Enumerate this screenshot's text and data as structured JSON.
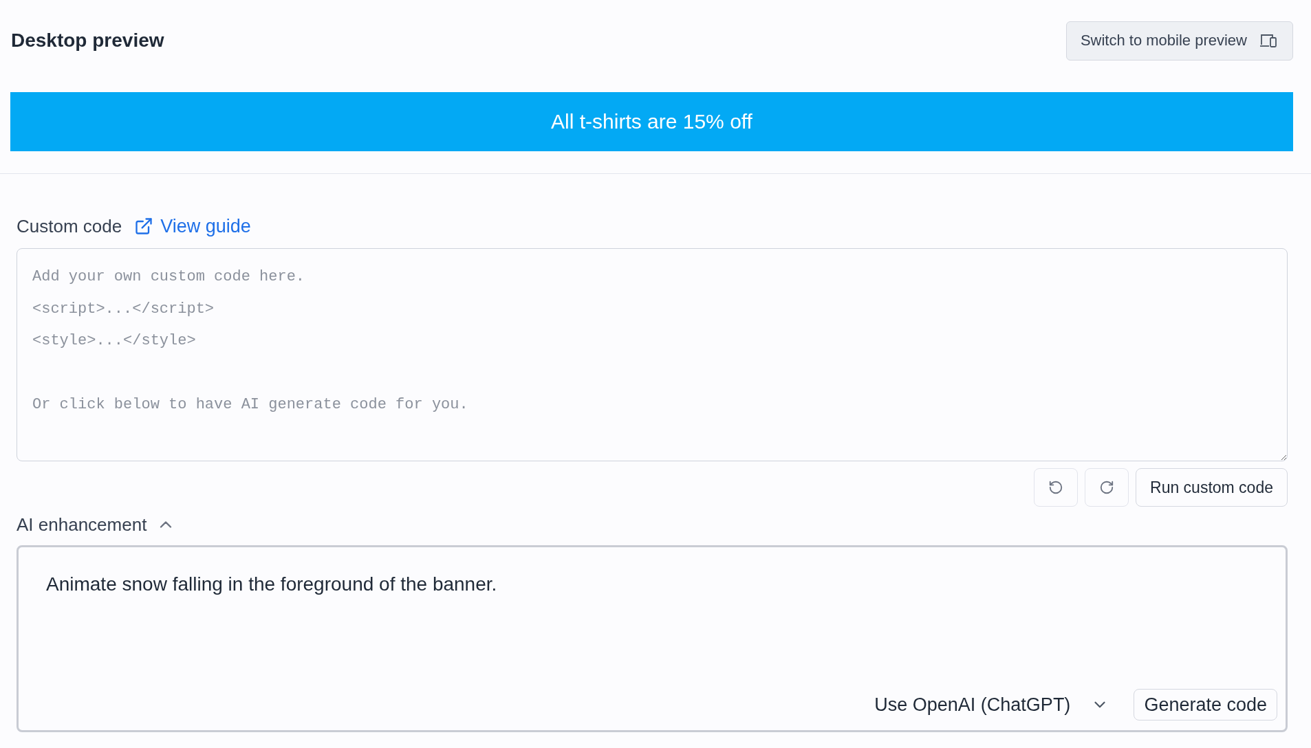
{
  "header": {
    "title": "Desktop preview",
    "switch_button": "Switch to mobile preview"
  },
  "banner": {
    "text": "All t-shirts are 15% off"
  },
  "custom_code": {
    "label": "Custom code",
    "guide_link": "View guide",
    "placeholder": "Add your own custom code here.\n<script>...</script>\n<style>...</style>\n\nOr click below to have AI generate code for you.",
    "run_button": "Run custom code"
  },
  "ai_enhancement": {
    "label": "AI enhancement",
    "expanded": true,
    "prompt": "Animate snow falling in the foreground of the banner.",
    "model": "Use OpenAI (ChatGPT)",
    "generate_button": "Generate code"
  }
}
